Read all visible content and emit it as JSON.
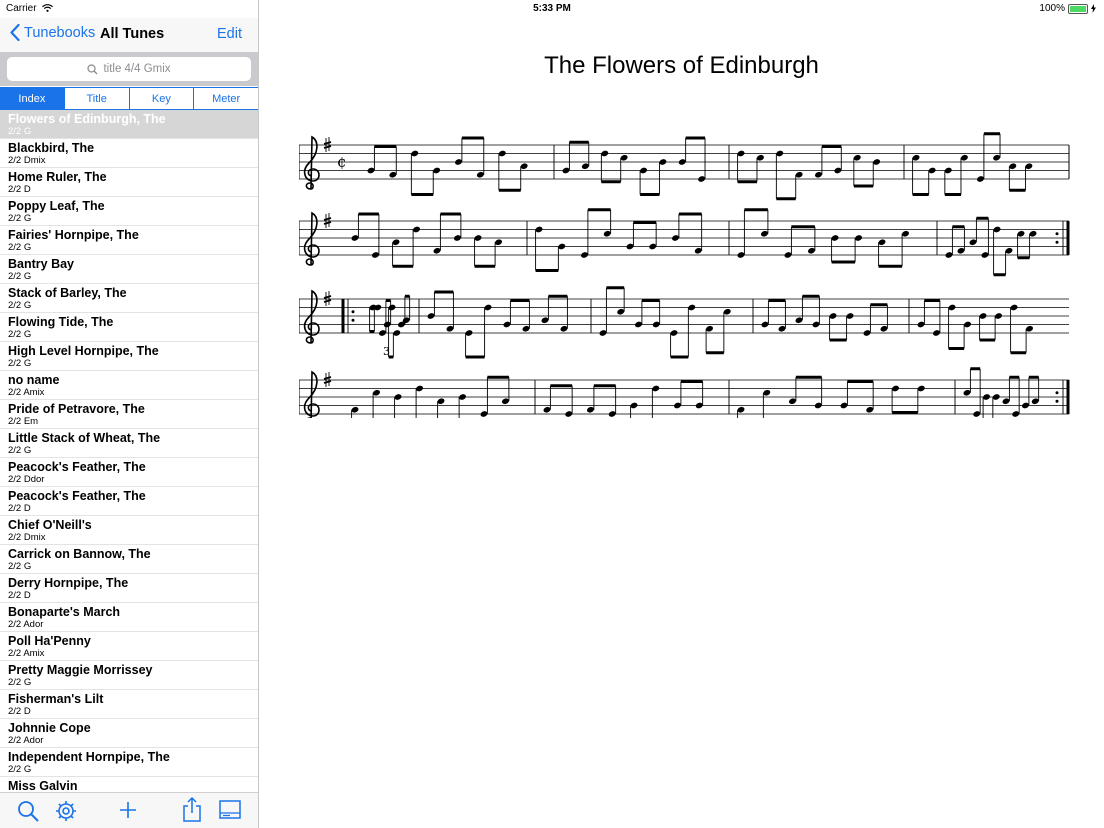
{
  "status": {
    "carrier": "Carrier",
    "time": "5:33 PM",
    "battery": "100%"
  },
  "nav": {
    "back_label": "Tunebooks",
    "title": "All Tunes",
    "edit_label": "Edit"
  },
  "search": {
    "placeholder": "title 4/4 Gmix"
  },
  "segments": [
    "Index",
    "Title",
    "Key",
    "Meter"
  ],
  "selected_segment": "Index",
  "tunes": [
    {
      "name": "Flowers of Edinburgh, The",
      "meta": "2/2 G"
    },
    {
      "name": "Blackbird, The",
      "meta": "2/2 Dmix"
    },
    {
      "name": "Home Ruler, The",
      "meta": "2/2 D"
    },
    {
      "name": "Poppy Leaf, The",
      "meta": "2/2 G"
    },
    {
      "name": "Fairies' Hornpipe, The",
      "meta": "2/2 G"
    },
    {
      "name": "Bantry Bay",
      "meta": "2/2 G"
    },
    {
      "name": "Stack of Barley, The",
      "meta": "2/2 G"
    },
    {
      "name": "Flowing Tide, The",
      "meta": "2/2 G"
    },
    {
      "name": "High Level Hornpipe, The",
      "meta": "2/2 G"
    },
    {
      "name": "no name",
      "meta": "2/2 Amix"
    },
    {
      "name": "Pride of Petravore, The",
      "meta": "2/2 Em"
    },
    {
      "name": "Little Stack of Wheat, The",
      "meta": "2/2 G"
    },
    {
      "name": "Peacock's Feather, The",
      "meta": "2/2 Ddor"
    },
    {
      "name": "Peacock's Feather, The",
      "meta": "2/2 D"
    },
    {
      "name": "Chief O'Neill's",
      "meta": "2/2 Dmix"
    },
    {
      "name": "Carrick on Bannow, The",
      "meta": "2/2 G"
    },
    {
      "name": "Derry Hornpipe, The",
      "meta": "2/2 D"
    },
    {
      "name": "Bonaparte's March",
      "meta": "2/2 Ador"
    },
    {
      "name": "Poll Ha'Penny",
      "meta": "2/2 Amix"
    },
    {
      "name": "Pretty Maggie Morrissey",
      "meta": "2/2 G"
    },
    {
      "name": "Fisherman's Lilt",
      "meta": "2/2 D"
    },
    {
      "name": "Johnnie Cope",
      "meta": "2/2 Ador"
    },
    {
      "name": "Independent Hornpipe, The",
      "meta": "2/2 G"
    },
    {
      "name": "Miss Galvin",
      "meta": ""
    }
  ],
  "toolbar_icons": [
    "search-icon",
    "gear-icon",
    "plus-icon",
    "share-icon",
    "display-icon"
  ],
  "tune_title": "The Flowers of Edinburgh",
  "score": {
    "tuplet_label": "3",
    "systems": [
      {
        "start_repeat": false,
        "end": "final"
      },
      {
        "start_repeat": false,
        "end": "end-repeat"
      },
      {
        "start_repeat": true,
        "end": "none"
      },
      {
        "start_repeat": false,
        "end": "end-repeat"
      }
    ]
  },
  "colors": {
    "accent": "#1a73e8",
    "selected_row": "#d6d6d6"
  }
}
